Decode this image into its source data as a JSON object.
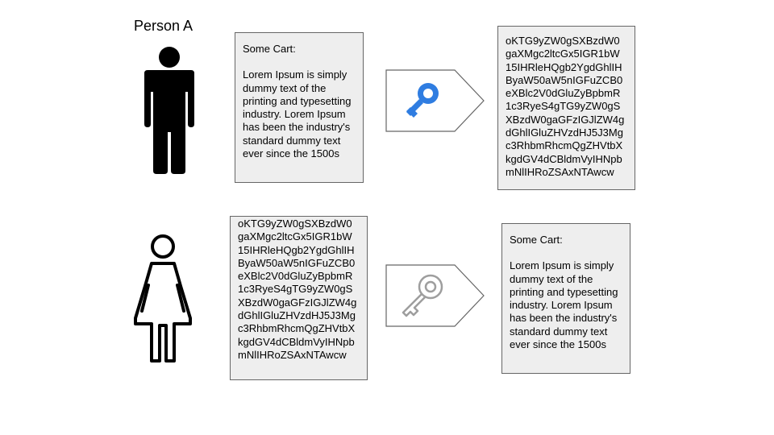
{
  "labels": {
    "person_a": "Person A"
  },
  "plain_message": {
    "title": "Some Cart:",
    "body": "Lorem Ipsum is simply\ndummy text of the\nprinting and typesetting\nindustry. Lorem Ipsum\nhas been the industry's\nstandard dummy text\never since the 1500s"
  },
  "cipher_text": "oKTG9yZW0gSXBzdW0\ngaXMgc2ltcGx5IGR1bW\n15IHRleHQgb2YgdGhlIH\nByaW50aW5nIGFuZCB0\neXBlc2V0dGluZyBpbmR\n1c3RyeS4gTG9yZW0gS\nXBzdW0gaGFzIGJlZW4g\ndGhlIGluZHVzdHJ5J3Mg\nc3RhbmRhcmQgZHVtbX\nkgdGV4dCBldmVyIHNpb\nmNlIHRoZSAxNTAwcw",
  "colors": {
    "box_fill": "#eeeeee",
    "box_border": "#666666",
    "encrypt_key": "#2f7de1",
    "decrypt_key": "#9e9e9e",
    "figure": "#000000"
  },
  "icons": {
    "sender": "man-figure-icon",
    "receiver": "woman-figure-icon",
    "encrypt": "blue-key-icon",
    "decrypt": "gray-key-icon"
  }
}
